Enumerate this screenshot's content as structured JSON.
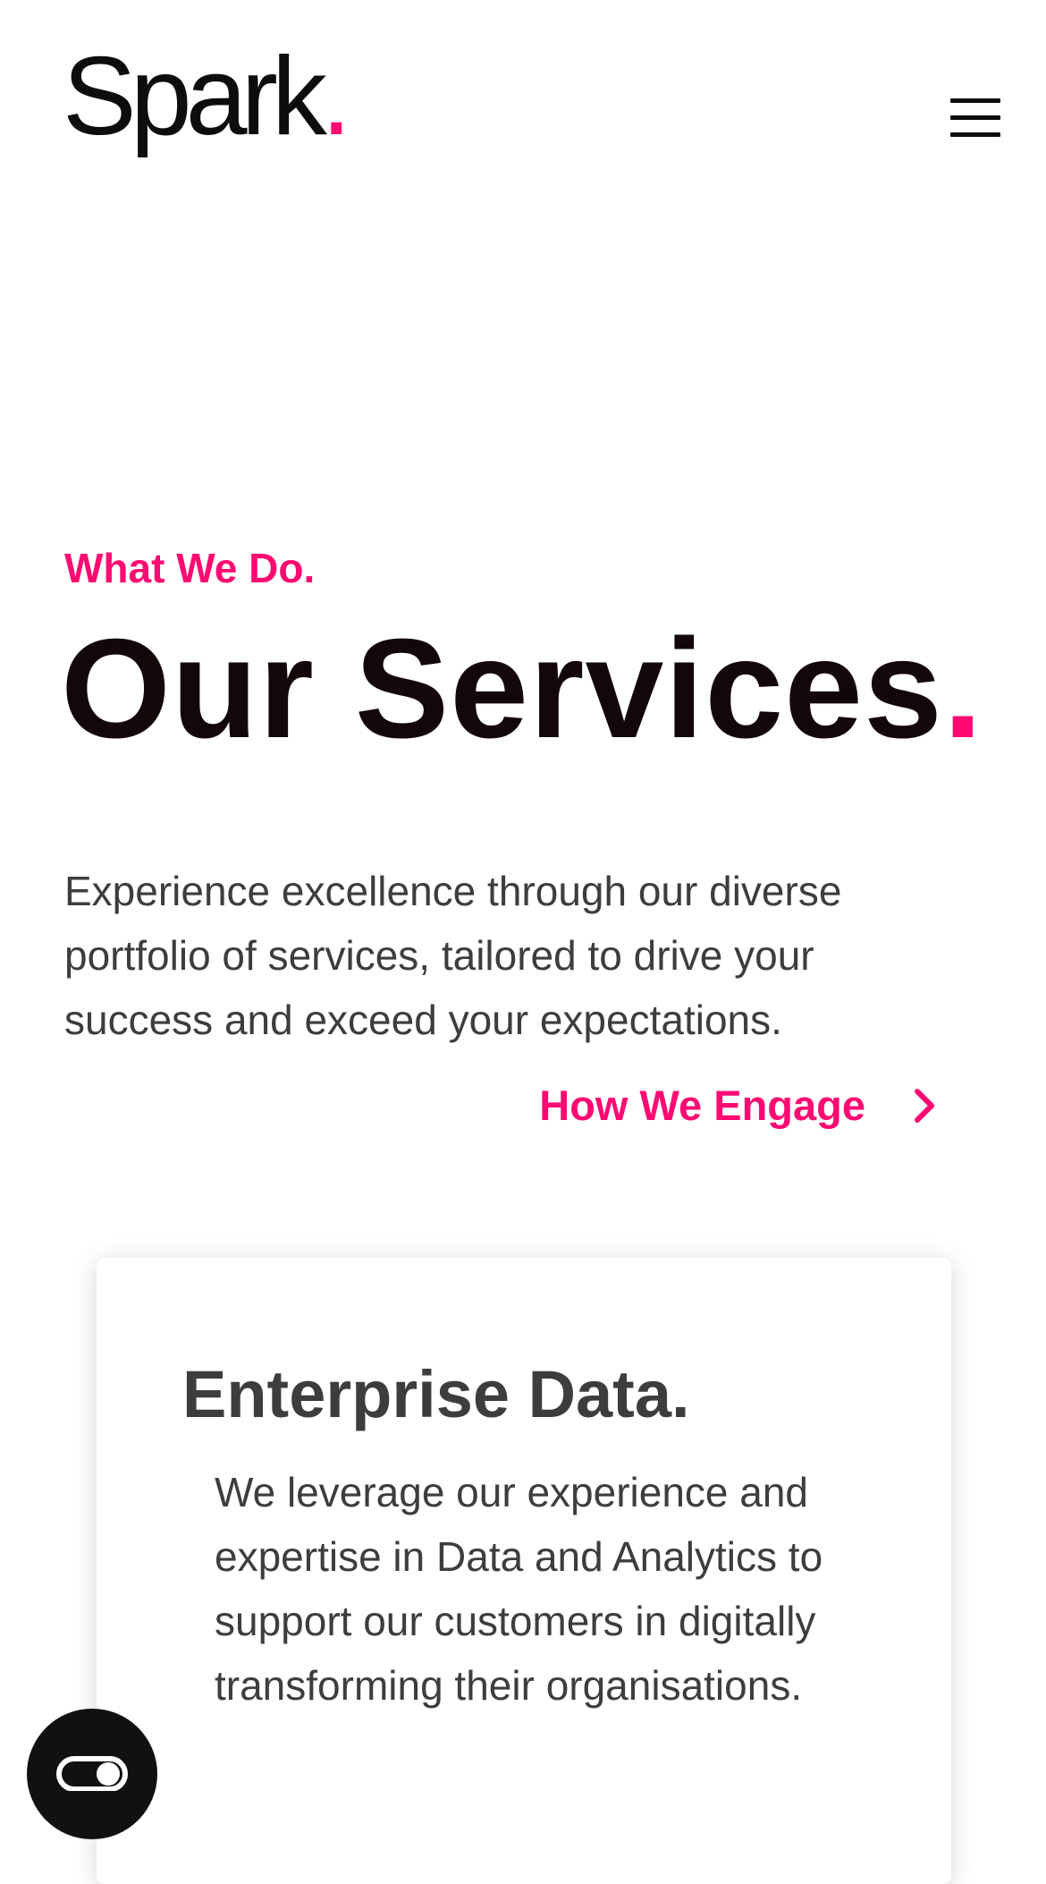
{
  "header": {
    "logo_text": "Spark",
    "logo_dot": ".",
    "menu_icon": "hamburger-menu-icon"
  },
  "hero": {
    "eyebrow": "What We Do.",
    "title": "Our Services",
    "title_dot": ".",
    "intro": "Experience excellence through our diverse portfolio of services, tailored to drive your success and exceed your expectations."
  },
  "engage_link": {
    "label": "How We Engage",
    "icon": "chevron-right-icon"
  },
  "service_card": {
    "title": "Enterprise Data.",
    "body": "We leverage our experience and expertise in Data and Analytics to support our customers in digitally transforming their organisations."
  },
  "floating_button": {
    "icon": "toggle-icon"
  },
  "colors": {
    "accent": "#ff0a72",
    "heading": "#14070b",
    "text": "#3d3d3d",
    "background": "#ffffff"
  }
}
